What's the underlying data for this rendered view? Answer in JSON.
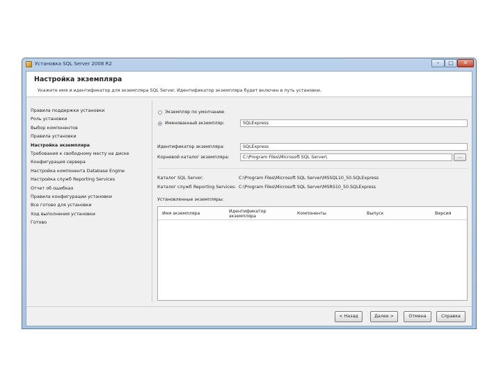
{
  "window": {
    "title": "Установка SQL Server 2008 R2",
    "min_glyph": "–",
    "max_glyph": "□",
    "close_glyph": "✕"
  },
  "header": {
    "title": "Настройка экземпляра",
    "description": "Укажите имя и идентификатор для экземпляра SQL Server. Идентификатор экземпляра будет включен в путь установки."
  },
  "nav": {
    "items": [
      "Правила поддержки установки",
      "Роль установки",
      "Выбор компонентов",
      "Правила установки",
      "Настройка экземпляра",
      "Требования к свободному месту на диске",
      "Конфигурация сервера",
      "Настройка компонента Database Engine",
      "Настройка служб Reporting Services",
      "Отчет об ошибках",
      "Правила конфигурации установки",
      "Все готово для установки",
      "Ход выполнения установки",
      "Готово"
    ],
    "active_index": 4
  },
  "form": {
    "default_instance_label": "Экземпляр по умолчанию",
    "named_instance_label": "Именованный экземпляр:",
    "named_instance_value": "SQLExpress",
    "default_instance_selected": false,
    "instance_id_label": "Идентификатор экземпляра:",
    "instance_id_value": "SQLExpress",
    "root_dir_label": "Корневой каталог экземпляра:",
    "root_dir_value": "C:\\Program Files\\Microsoft SQL Server\\",
    "browse_label": "..."
  },
  "dirs": {
    "sql_label": "Каталог SQL Server:",
    "sql_value": "C:\\Program Files\\Microsoft SQL Server\\MSSQL10_50.SQLExpress",
    "rs_label": "Каталог служб Reporting Services:",
    "rs_value": "C:\\Program Files\\Microsoft SQL Server\\MSRS10_50.SQLExpress"
  },
  "instances": {
    "label": "Установленные экземпляры:",
    "columns": [
      "Имя экземпляра",
      "Идентификатор экземпляра",
      "Компоненты",
      "Выпуск",
      "Версия"
    ],
    "rows": []
  },
  "buttons": {
    "back": "< Назад",
    "next": "Далее >",
    "cancel": "Отмена",
    "help": "Справка"
  }
}
